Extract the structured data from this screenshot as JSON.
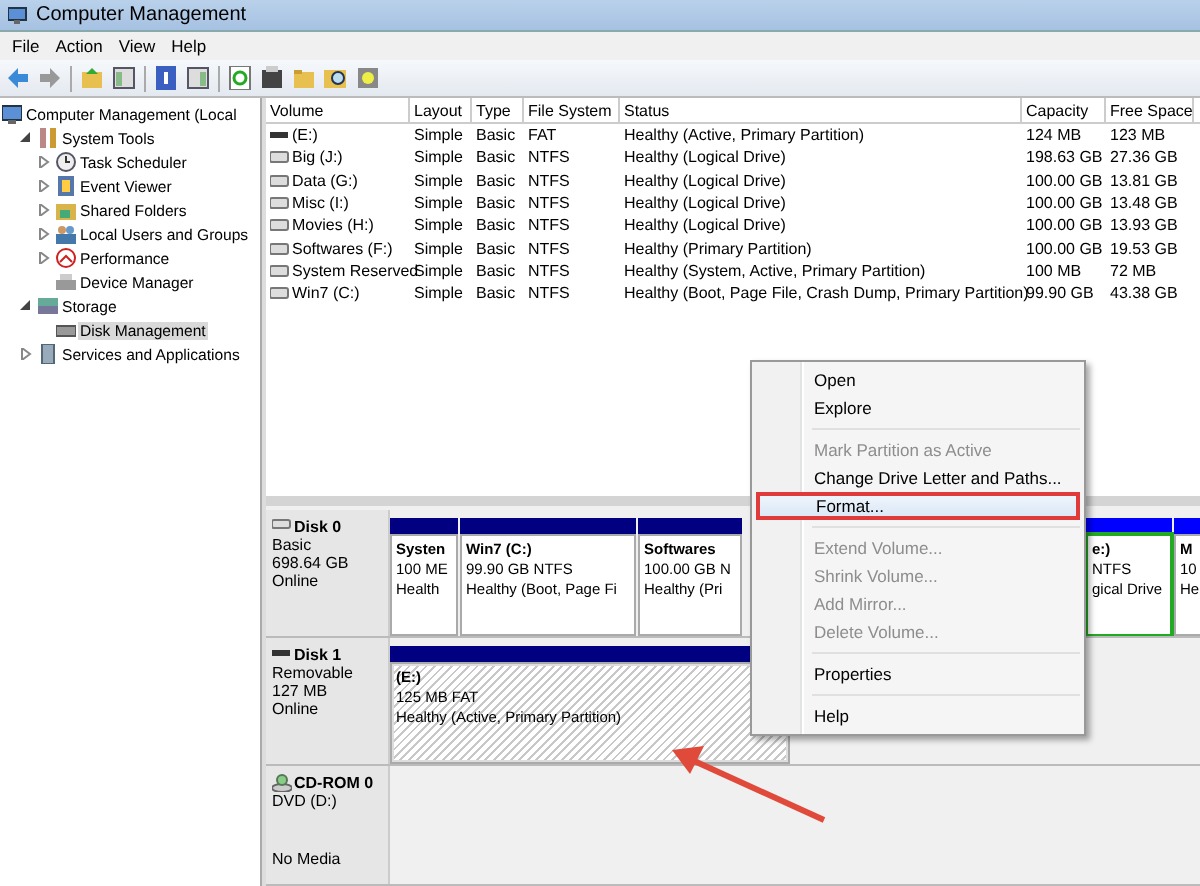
{
  "window": {
    "title": "Computer Management"
  },
  "menu_bar": [
    "File",
    "Action",
    "View",
    "Help"
  ],
  "tree": [
    {
      "label": "Computer Management (Local",
      "selected": false,
      "children": [
        {
          "label": "System Tools",
          "expanded": true,
          "selected": false,
          "children": [
            {
              "label": "Task Scheduler",
              "expanded": false,
              "selected": false
            },
            {
              "label": "Event Viewer",
              "expanded": false,
              "selected": false
            },
            {
              "label": "Shared Folders",
              "expanded": false,
              "selected": false
            },
            {
              "label": "Local Users and Groups",
              "expanded": false,
              "selected": false
            },
            {
              "label": "Performance",
              "expanded": false,
              "selected": false
            },
            {
              "label": "Device Manager",
              "selected": false
            }
          ]
        },
        {
          "label": "Storage",
          "expanded": true,
          "selected": false,
          "children": [
            {
              "label": "Disk Management",
              "selected": true
            }
          ]
        },
        {
          "label": "Services and Applications",
          "expanded": false,
          "selected": false
        }
      ]
    }
  ],
  "table": {
    "columns": [
      "Volume",
      "Layout",
      "Type",
      "File System",
      "Status",
      "Capacity",
      "Free Space"
    ],
    "rows": [
      {
        "kind": "removable",
        "cells": [
          "(E:)",
          "Simple",
          "Basic",
          "FAT",
          "Healthy (Active, Primary Partition)",
          "124 MB",
          "123 MB"
        ]
      },
      {
        "kind": "disk",
        "cells": [
          "Big (J:)",
          "Simple",
          "Basic",
          "NTFS",
          "Healthy (Logical Drive)",
          "198.63 GB",
          "27.36 GB"
        ]
      },
      {
        "kind": "disk",
        "cells": [
          "Data (G:)",
          "Simple",
          "Basic",
          "NTFS",
          "Healthy (Logical Drive)",
          "100.00 GB",
          "13.81 GB"
        ]
      },
      {
        "kind": "disk",
        "cells": [
          "Misc (I:)",
          "Simple",
          "Basic",
          "NTFS",
          "Healthy (Logical Drive)",
          "100.00 GB",
          "13.48 GB"
        ]
      },
      {
        "kind": "disk",
        "cells": [
          "Movies (H:)",
          "Simple",
          "Basic",
          "NTFS",
          "Healthy (Logical Drive)",
          "100.00 GB",
          "13.93 GB"
        ]
      },
      {
        "kind": "disk",
        "cells": [
          "Softwares (F:)",
          "Simple",
          "Basic",
          "NTFS",
          "Healthy (Primary Partition)",
          "100.00 GB",
          "19.53 GB"
        ]
      },
      {
        "kind": "disk",
        "cells": [
          "System Reserved",
          "Simple",
          "Basic",
          "NTFS",
          "Healthy (System, Active, Primary Partition)",
          "100 MB",
          "72 MB"
        ]
      },
      {
        "kind": "disk",
        "cells": [
          "Win7 (C:)",
          "Simple",
          "Basic",
          "NTFS",
          "Healthy (Boot, Page File, Crash Dump, Primary Partition)",
          "99.90 GB",
          "43.38 GB"
        ]
      }
    ]
  },
  "disks": [
    {
      "kind": "disk",
      "name": "Disk 0",
      "type": "Basic",
      "size": "698.64 GB",
      "status": "Online",
      "partitions": [
        {
          "lines": [
            "Systen",
            "100 ME",
            "Health"
          ],
          "color": "#000080",
          "selected": false
        },
        {
          "lines": [
            "Win7  (C:)",
            "99.90 GB NTFS",
            "Healthy (Boot, Page Fi"
          ],
          "color": "#000080",
          "selected": false
        },
        {
          "lines": [
            "Softwares",
            "100.00 GB N",
            "Healthy (Pri"
          ],
          "color": "#000080",
          "selected": false
        },
        {
          "kind": "hidden"
        },
        {
          "lines": [
            "e:)",
            "NTFS",
            "gical Drive"
          ],
          "color": "#0000ff",
          "logical": true,
          "selected": false
        },
        {
          "lines": [
            "M",
            "10",
            "He"
          ],
          "color": "#0000ff",
          "selected": false
        }
      ]
    },
    {
      "kind": "removable",
      "name": "Disk 1",
      "type": "Removable",
      "size": "127 MB",
      "status": "Online",
      "partitions": [
        {
          "lines": [
            "(E:)",
            "125 MB FAT",
            "Healthy (Active, Primary Partition)"
          ],
          "color": "#000080",
          "selected": true
        }
      ]
    },
    {
      "kind": "cdrom",
      "name": "CD-ROM 0",
      "type": "DVD (D:)",
      "status": "No Media"
    }
  ],
  "context_menu": [
    {
      "kind": "item",
      "label": "Open",
      "disabled": false,
      "selected": false
    },
    {
      "kind": "item",
      "label": "Explore",
      "disabled": false,
      "selected": false
    },
    {
      "kind": "separator"
    },
    {
      "kind": "item",
      "label": "Mark Partition as Active",
      "disabled": true,
      "selected": false
    },
    {
      "kind": "item",
      "label": "Change Drive Letter and Paths...",
      "disabled": false,
      "selected": false
    },
    {
      "kind": "item",
      "label": "Format...",
      "disabled": false,
      "selected": true,
      "callout": true
    },
    {
      "kind": "separator"
    },
    {
      "kind": "item",
      "label": "Extend Volume...",
      "disabled": true,
      "selected": false
    },
    {
      "kind": "item",
      "label": "Shrink Volume...",
      "disabled": true,
      "selected": false
    },
    {
      "kind": "item",
      "label": "Add Mirror...",
      "disabled": true,
      "selected": false
    },
    {
      "kind": "item",
      "label": "Delete Volume...",
      "disabled": true,
      "selected": false
    },
    {
      "kind": "separator"
    },
    {
      "kind": "item",
      "label": "Properties",
      "disabled": false,
      "selected": false
    },
    {
      "kind": "separator"
    },
    {
      "kind": "item",
      "label": "Help",
      "disabled": false,
      "selected": false
    }
  ]
}
